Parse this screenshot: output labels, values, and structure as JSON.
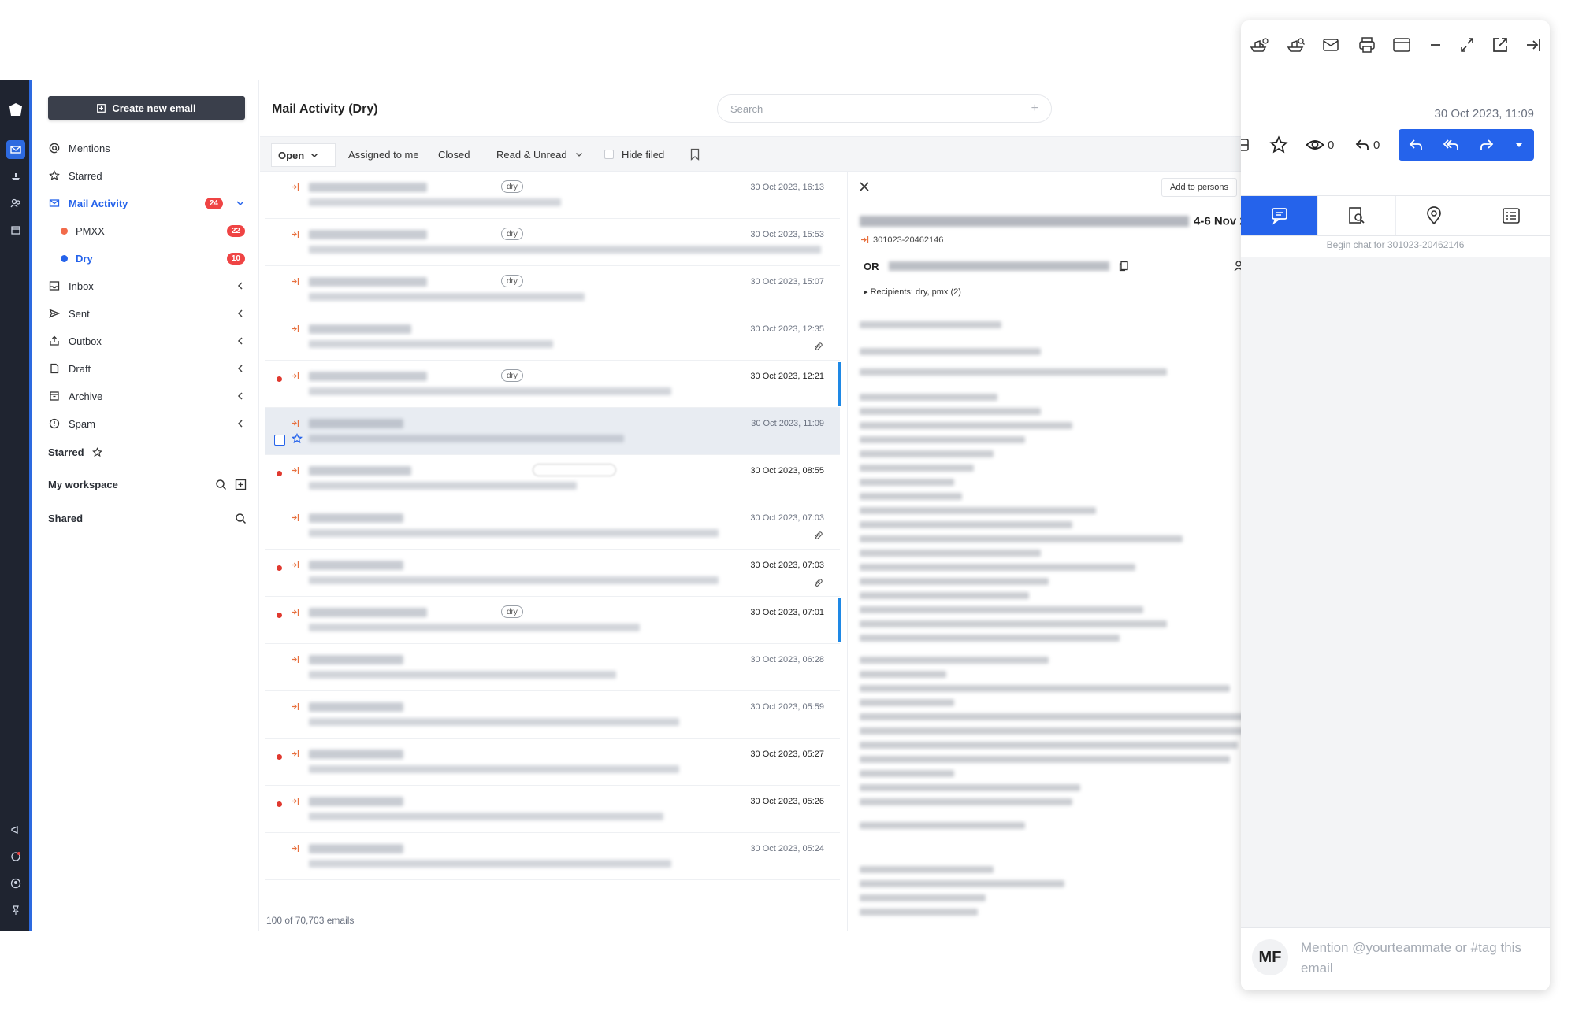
{
  "sidebar": {
    "compose_label": "Create new email",
    "nav": [
      {
        "label": "Mentions",
        "icon": "at-icon"
      },
      {
        "label": "Starred",
        "icon": "star-icon"
      },
      {
        "label": "Mail Activity",
        "icon": "mail-icon",
        "badge": "24"
      },
      {
        "label": "Inbox",
        "icon": "inbox-icon"
      },
      {
        "label": "Sent",
        "icon": "send-icon"
      },
      {
        "label": "Outbox",
        "icon": "outbox-icon"
      },
      {
        "label": "Draft",
        "icon": "draft-icon"
      },
      {
        "label": "Archive",
        "icon": "archive-icon"
      },
      {
        "label": "Spam",
        "icon": "spam-icon"
      }
    ],
    "sub": [
      {
        "label": "PMXX",
        "badge": "22",
        "color": "#f26b4b"
      },
      {
        "label": "Dry",
        "badge": "10",
        "color": "#2563eb"
      }
    ],
    "starred_heading": "Starred",
    "workspace_heading": "My workspace",
    "shared_heading": "Shared"
  },
  "header": {
    "title": "Mail Activity (Dry)",
    "search_placeholder": "Search"
  },
  "filters": {
    "open": "Open",
    "assigned": "Assigned to me",
    "closed": "Closed",
    "read_unread": "Read & Unread",
    "hide_filed": "Hide filed"
  },
  "emails": [
    {
      "tag": "dry",
      "date": "30 Oct 2023, 16:13",
      "unread": false
    },
    {
      "tag": "dry",
      "date": "30 Oct 2023, 15:53",
      "unread": false
    },
    {
      "tag": "dry",
      "date": "30 Oct 2023, 15:07",
      "unread": false
    },
    {
      "tag": "",
      "date": "30 Oct 2023, 12:35",
      "unread": false
    },
    {
      "tag": "dry",
      "date": "30 Oct 2023, 12:21",
      "unread": true
    },
    {
      "tag": "",
      "date": "30 Oct 2023, 11:09",
      "unread": false
    },
    {
      "tag": "",
      "date": "30 Oct 2023, 08:55",
      "unread": true
    },
    {
      "tag": "",
      "date": "30 Oct 2023, 07:03",
      "unread": false
    },
    {
      "tag": "",
      "date": "30 Oct 2023, 07:03",
      "unread": true
    },
    {
      "tag": "dry",
      "date": "30 Oct 2023, 07:01",
      "unread": true
    },
    {
      "tag": "",
      "date": "30 Oct 2023, 06:28",
      "unread": false
    },
    {
      "tag": "",
      "date": "30 Oct 2023, 05:59",
      "unread": false
    },
    {
      "tag": "",
      "date": "30 Oct 2023, 05:27",
      "unread": true
    },
    {
      "tag": "",
      "date": "30 Oct 2023, 05:26",
      "unread": true
    },
    {
      "tag": "",
      "date": "30 Oct 2023, 05:24",
      "unread": false
    }
  ],
  "list_footer": "100 of 70,703 emails",
  "preview": {
    "add_to_persons": "Add to persons",
    "title_tail": "4-6 Nov 2",
    "email_id": "301023-20462146",
    "or_label": "OR",
    "recipients": "Recipients: dry, pmx (2)"
  },
  "panel": {
    "date": "30 Oct 2023, 11:09",
    "views_count": "0",
    "replies_count": "0",
    "chat_hint": "Begin chat for 301023-20462146",
    "avatar_initials": "MF",
    "mention_placeholder": "Mention @yourteammate or #tag this email"
  }
}
